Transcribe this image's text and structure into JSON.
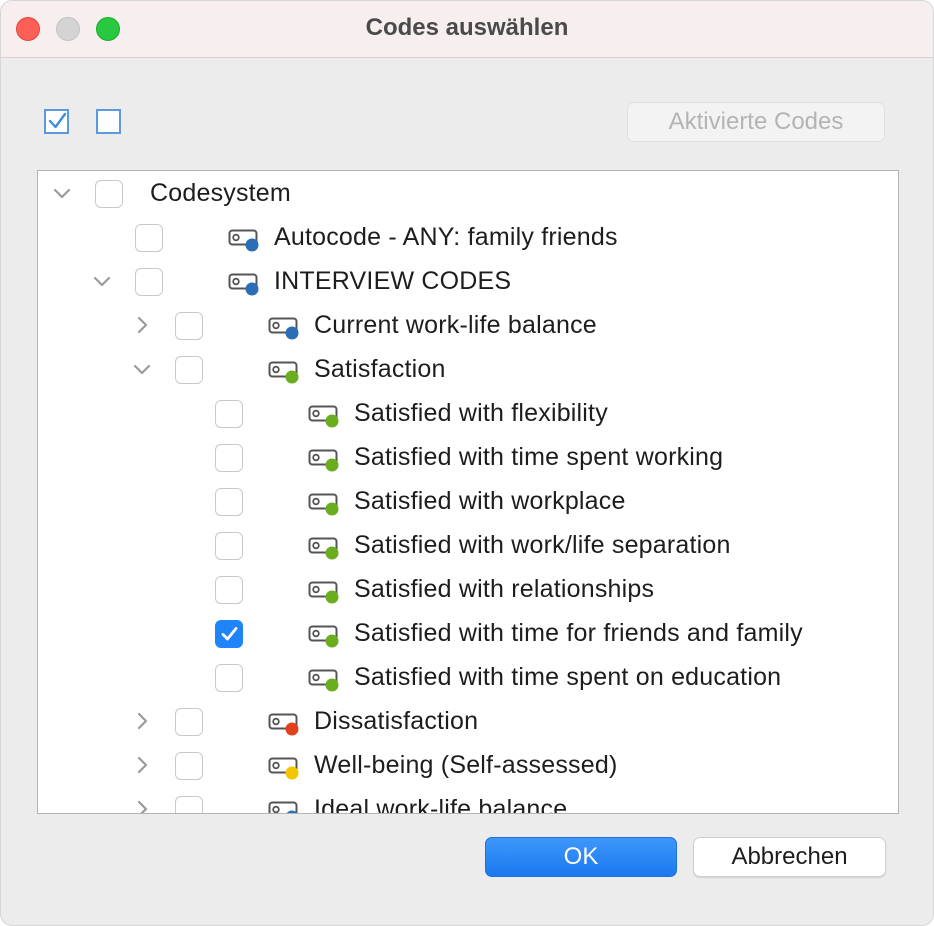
{
  "window": {
    "title": "Codes auswählen"
  },
  "toolbar": {
    "activated_codes_label": "Aktivierte Codes"
  },
  "tree": {
    "items": [
      {
        "label": "Codesystem",
        "expander": "expanded",
        "checked": false,
        "icon": "none"
      },
      {
        "label": "Autocode - ANY: family  friends",
        "expander": "none",
        "checked": false,
        "icon": "code-icon",
        "color": "#2c6eb5"
      },
      {
        "label": "INTERVIEW CODES",
        "expander": "expanded",
        "checked": false,
        "icon": "code-icon",
        "color": "#2c6eb5"
      },
      {
        "label": "Current work-life balance",
        "expander": "collapsed",
        "checked": false,
        "icon": "code-icon",
        "color": "#2c6eb5"
      },
      {
        "label": "Satisfaction",
        "expander": "expanded",
        "checked": false,
        "icon": "code-icon",
        "color": "#6aad1e"
      },
      {
        "label": "Satisfied with flexibility",
        "expander": "none",
        "checked": false,
        "icon": "code-icon",
        "color": "#6aad1e"
      },
      {
        "label": "Satisfied with time spent working",
        "expander": "none",
        "checked": false,
        "icon": "code-icon",
        "color": "#6aad1e"
      },
      {
        "label": "Satisfied with workplace",
        "expander": "none",
        "checked": false,
        "icon": "code-icon",
        "color": "#6aad1e"
      },
      {
        "label": "Satisfied with work/life separation",
        "expander": "none",
        "checked": false,
        "icon": "code-icon",
        "color": "#6aad1e"
      },
      {
        "label": "Satisfied with relationships",
        "expander": "none",
        "checked": false,
        "icon": "code-icon",
        "color": "#6aad1e"
      },
      {
        "label": "Satisfied with time for friends and family",
        "expander": "none",
        "checked": true,
        "icon": "code-icon",
        "color": "#6aad1e"
      },
      {
        "label": "Satisfied with time spent on education",
        "expander": "none",
        "checked": false,
        "icon": "code-icon",
        "color": "#6aad1e"
      },
      {
        "label": "Dissatisfaction",
        "expander": "collapsed",
        "checked": false,
        "icon": "code-icon",
        "color": "#e0401c"
      },
      {
        "label": "Well-being (Self-assessed)",
        "expander": "collapsed",
        "checked": false,
        "icon": "code-icon",
        "color": "#f2c600"
      },
      {
        "label": "Ideal work-life balance",
        "expander": "collapsed",
        "checked": false,
        "icon": "code-icon",
        "color": "#2c6eb5"
      }
    ]
  },
  "footer": {
    "ok_label": "OK",
    "cancel_label": "Abbrechen"
  }
}
